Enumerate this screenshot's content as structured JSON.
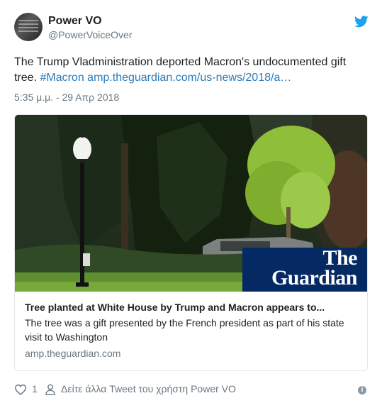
{
  "author": {
    "name": "Power VO",
    "handle": "@PowerVoiceOver"
  },
  "icons": {
    "header_right": "twitter-bird-icon",
    "like": "heart-icon",
    "more": "person-icon",
    "info": "info-icon"
  },
  "tweet": {
    "text": "The Trump Vladministration deported Macron's undocumented gift tree. ",
    "hashtag": "#Macron",
    "url": "amp.theguardian.com/us-news/2018/a…",
    "timestamp": "5:35 μ.μ. - 29 Απρ 2018"
  },
  "card": {
    "logo_line1": "The",
    "logo_line2": "Guardian",
    "title": "Tree planted at White House by Trump and Macron appears to...",
    "description": "The tree was a gift presented by the French president as part of his state visit to Washington",
    "domain": "amp.theguardian.com"
  },
  "footer": {
    "like_count": "1",
    "more_tweets": "Δείτε άλλα Tweet του χρήστη Power VO",
    "info_glyph": "i"
  },
  "colors": {
    "link": "#2b7bb9",
    "twitter_blue": "#1da1f2",
    "secondary_text": "#697882",
    "guardian_navy": "#052962"
  }
}
